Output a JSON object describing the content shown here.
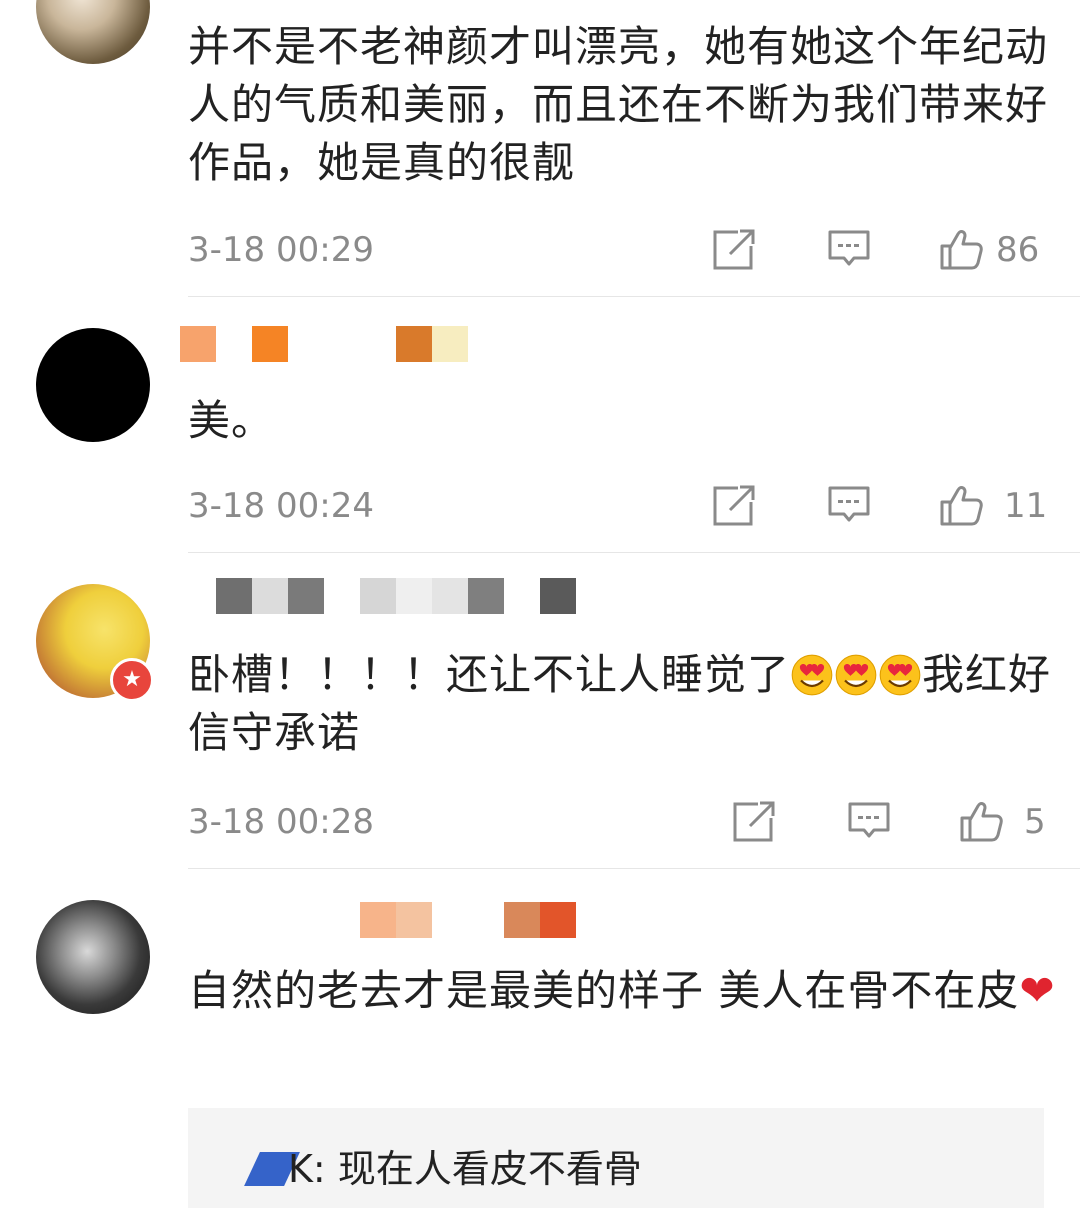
{
  "comments": [
    {
      "text": "并不是不老神颜才叫漂亮，她有她这个年纪动人的气质和美丽，而且还在不断为我们带来好作品，她是真的很靓",
      "time": "3-18 00:29",
      "likes": "86"
    },
    {
      "text": "美。",
      "time": "3-18 00:24",
      "likes": "11"
    },
    {
      "text": "卧槽！！！！还让不让人睡觉了",
      "text_after": "我红好信守承诺",
      "time": "3-18 00:28",
      "likes": "5"
    },
    {
      "text": "自然的老去才是最美的样子 美人在骨不在皮",
      "time": "",
      "likes": ""
    }
  ],
  "reply": {
    "prefix": "K: ",
    "text": "现在人看皮不看骨"
  },
  "icons": {
    "repost": "repost-icon",
    "comment": "comment-icon",
    "like": "thumbs-up-icon",
    "emoji": "heart-eyes-emoji",
    "heart": "red-heart-icon",
    "badge": "verified-badge-icon"
  },
  "colors": {
    "meta_gray": "#8a8a8a",
    "text": "#222222",
    "heart": "#e0242f",
    "badge": "#e8453c"
  }
}
